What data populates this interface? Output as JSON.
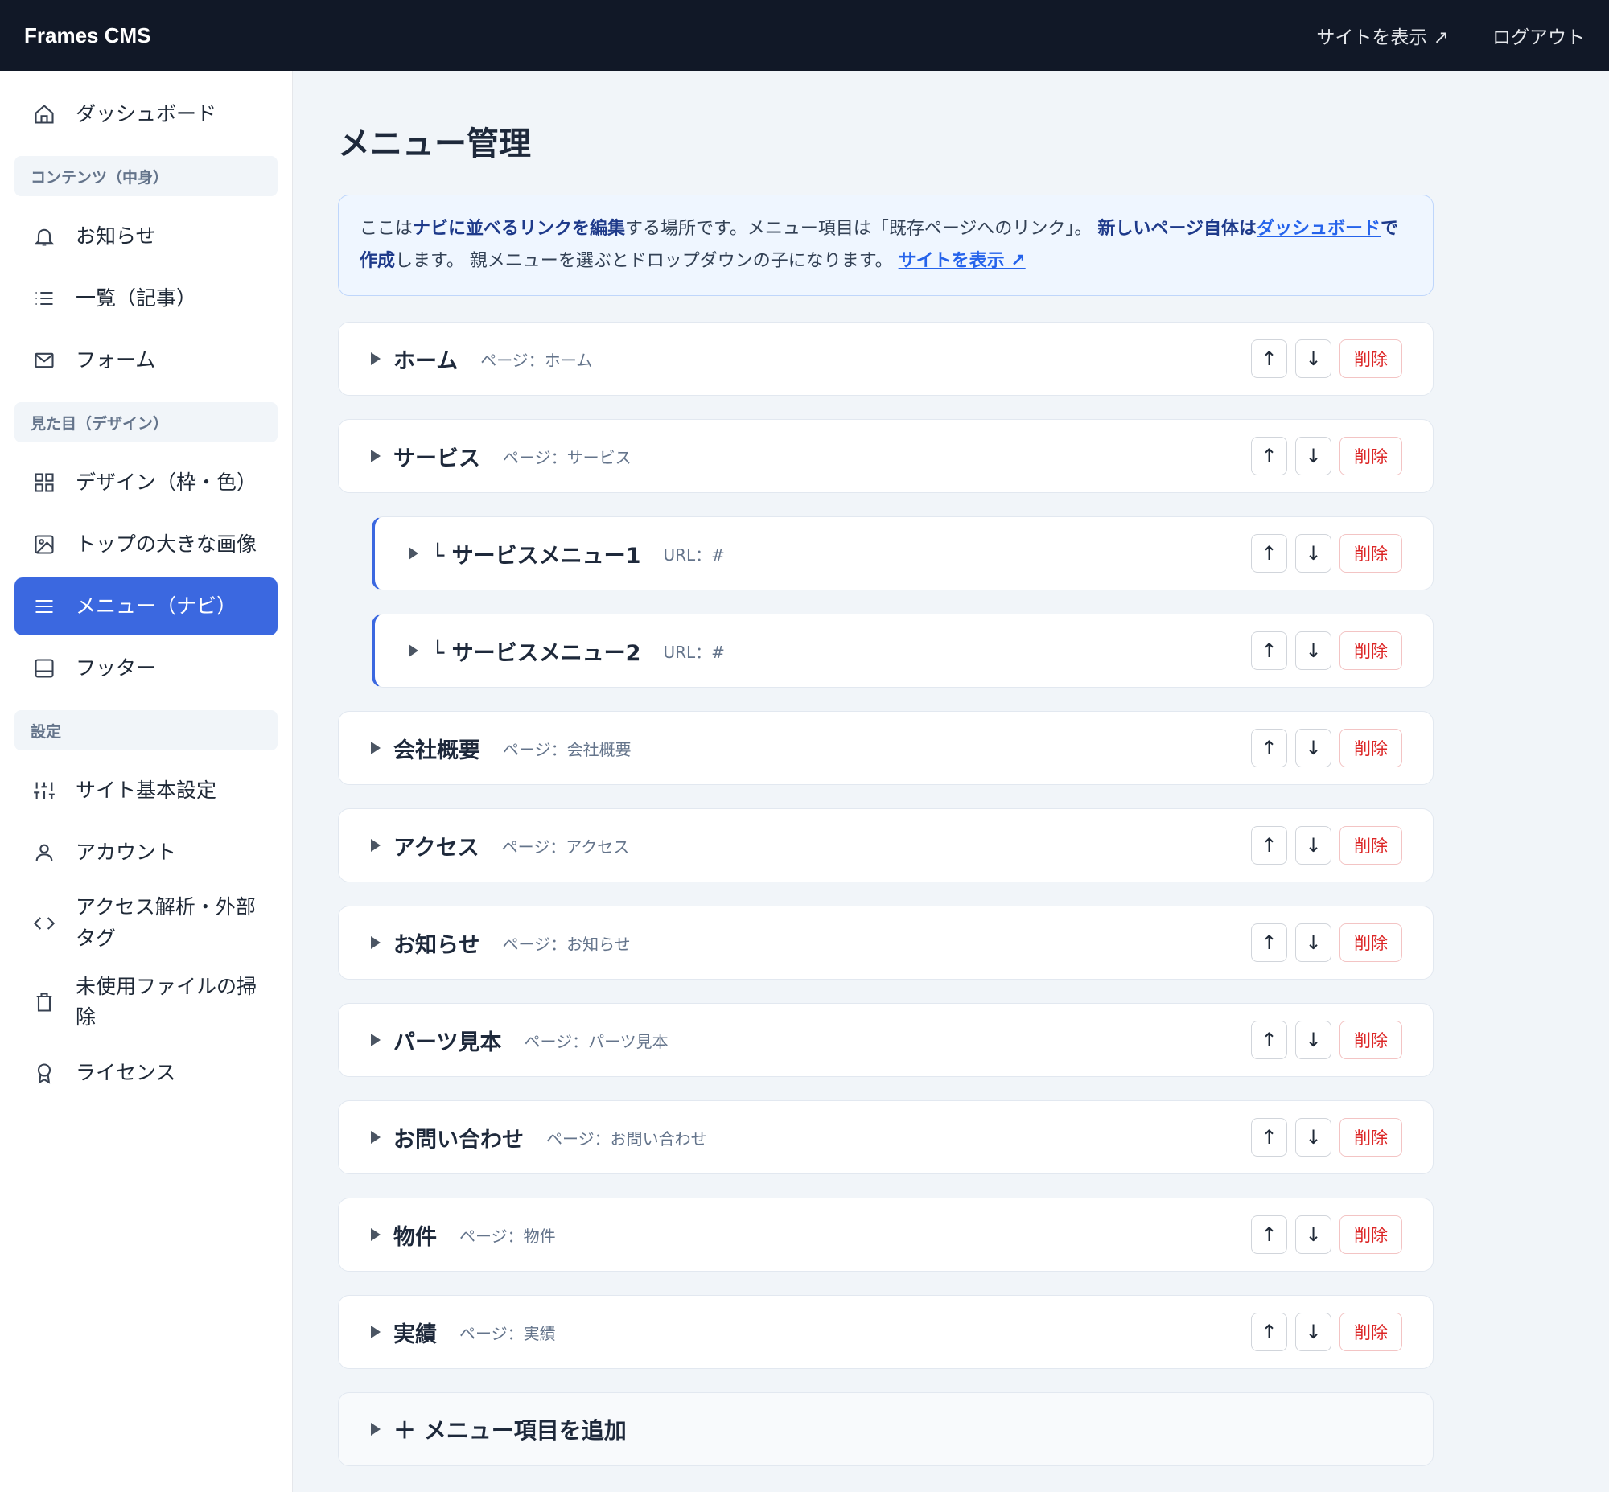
{
  "app": {
    "brand": "Frames CMS",
    "view_site": "サイトを表示 ↗",
    "logout": "ログアウト"
  },
  "sidebar": {
    "dashboard": "ダッシュボード",
    "section_content": "コンテンツ（中身）",
    "news": "お知らせ",
    "articles": "一覧（記事）",
    "forms": "フォーム",
    "section_design": "見た目（デザイン）",
    "design": "デザイン（枠・色）",
    "hero": "トップの大きな画像",
    "menu": "メニュー（ナビ）",
    "footer": "フッター",
    "section_settings": "設定",
    "site_settings": "サイト基本設定",
    "account": "アカウント",
    "analytics": "アクセス解析・外部タグ",
    "cleanup": "未使用ファイルの掃除",
    "license": "ライセンス"
  },
  "main": {
    "title": "メニュー管理",
    "notice": {
      "t1": "ここは",
      "b1": "ナビに並べるリンクを編集",
      "t2": "する場所です。メニュー項目は「既存ページへのリンク」。 ",
      "b2": "新しいページ自体は",
      "link1": "ダッシュボード",
      "b3": "で作成",
      "t3": "します。 親メニューを選ぶとドロップダウンの子になります。 ",
      "link2": "サイトを表示 ↗"
    },
    "up": "↑",
    "down": "↓",
    "delete": "削除",
    "items": [
      {
        "name": "ホーム",
        "meta": "ページ：ホーム"
      },
      {
        "name": "サービス",
        "meta": "ページ：サービス"
      },
      {
        "name": "└ サービスメニュー1",
        "meta": "URL：#"
      },
      {
        "name": "└ サービスメニュー2",
        "meta": "URL：#"
      },
      {
        "name": "会社概要",
        "meta": "ページ：会社概要"
      },
      {
        "name": "アクセス",
        "meta": "ページ：アクセス"
      },
      {
        "name": "お知らせ",
        "meta": "ページ：お知らせ"
      },
      {
        "name": "パーツ見本",
        "meta": "ページ：パーツ見本"
      },
      {
        "name": "お問い合わせ",
        "meta": "ページ：お問い合わせ"
      },
      {
        "name": "物件",
        "meta": "ページ：物件"
      },
      {
        "name": "実績",
        "meta": "ページ：実績"
      }
    ],
    "add_item": "＋ メニュー項目を追加"
  },
  "colors": {
    "topbar": "#111827",
    "accent": "#3b68e0",
    "danger": "#dc2626",
    "notice_bg": "#eff6ff"
  }
}
